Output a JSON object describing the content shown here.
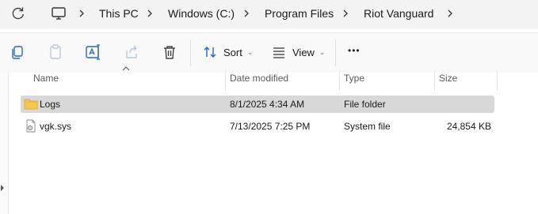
{
  "breadcrumb": [
    "This PC",
    "Windows (C:)",
    "Program Files",
    "Riot Vanguard"
  ],
  "toolbar": {
    "sort_label": "Sort",
    "view_label": "View",
    "more_label": "•••"
  },
  "columns": {
    "name": "Name",
    "date": "Date modified",
    "type": "Type",
    "size": "Size"
  },
  "files": [
    {
      "name": "Logs",
      "date": "8/1/2025 4:34 AM",
      "type": "File folder",
      "size": "",
      "icon": "folder-icon",
      "selected": true
    },
    {
      "name": "vgk.sys",
      "date": "7/13/2025 7:25 PM",
      "type": "System file",
      "size": "24,854 KB",
      "icon": "system-file-icon",
      "selected": false
    }
  ],
  "colors": {
    "folder": "#f7c64a",
    "selection": "#d8d8d8",
    "topbar": "#f3f3f3"
  }
}
